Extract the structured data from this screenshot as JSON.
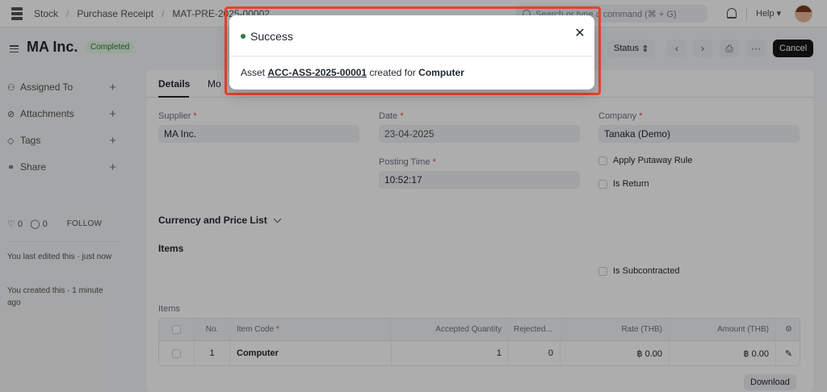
{
  "navbar": {
    "breadcrumbs": [
      "Stock",
      "Purchase Receipt",
      "MAT-PRE-2025-00002"
    ],
    "search_placeholder": "Search or type a command (⌘ + G)",
    "help_label": "Help"
  },
  "page": {
    "title": "MA Inc.",
    "status": "Completed",
    "status_button": "Status",
    "cancel_button": "Cancel"
  },
  "sidebar": {
    "items": [
      {
        "icon": "person-icon",
        "label": "Assigned To"
      },
      {
        "icon": "paperclip-icon",
        "label": "Attachments"
      },
      {
        "icon": "tag-icon",
        "label": "Tags"
      },
      {
        "icon": "share-icon",
        "label": "Share"
      }
    ],
    "likes": "0",
    "comments": "0",
    "follow_label": "FOLLOW",
    "last_edited": "You last edited this · just now",
    "created": "You created this · 1 minute ago"
  },
  "form": {
    "tabs": [
      "Details",
      "Mo"
    ],
    "fields": {
      "supplier": {
        "label": "Supplier",
        "value": "MA Inc."
      },
      "date": {
        "label": "Date",
        "value": "23-04-2025"
      },
      "posting_time": {
        "label": "Posting Time",
        "value": "10:52:17"
      },
      "company": {
        "label": "Company",
        "value": "Tanaka (Demo)"
      },
      "apply_putaway": "Apply Putaway Rule",
      "is_return": "Is Return",
      "is_subcontracted": "Is Subcontracted"
    },
    "sections": {
      "currency": "Currency and Price List",
      "items": "Items"
    },
    "items_grid": {
      "label": "Items",
      "columns": [
        "No.",
        "Item Code",
        "Accepted Quantity",
        "Rejected...",
        "Rate (THB)",
        "Amount (THB)"
      ],
      "rows": [
        {
          "no": "1",
          "item_code": "Computer",
          "accepted_qty": "1",
          "rejected_qty": "0",
          "rate": "฿ 0.00",
          "amount": "฿ 0.00"
        }
      ]
    },
    "download_button": "Download"
  },
  "modal": {
    "title": "Success",
    "status_color": "#2c7a3f",
    "message_prefix": "Asset",
    "asset_link": "ACC-ASS-2025-00001",
    "message_mid": "created for",
    "asset_item": "Computer"
  },
  "colors": {
    "highlight": "#e8432a",
    "primary_button": "#171717"
  }
}
